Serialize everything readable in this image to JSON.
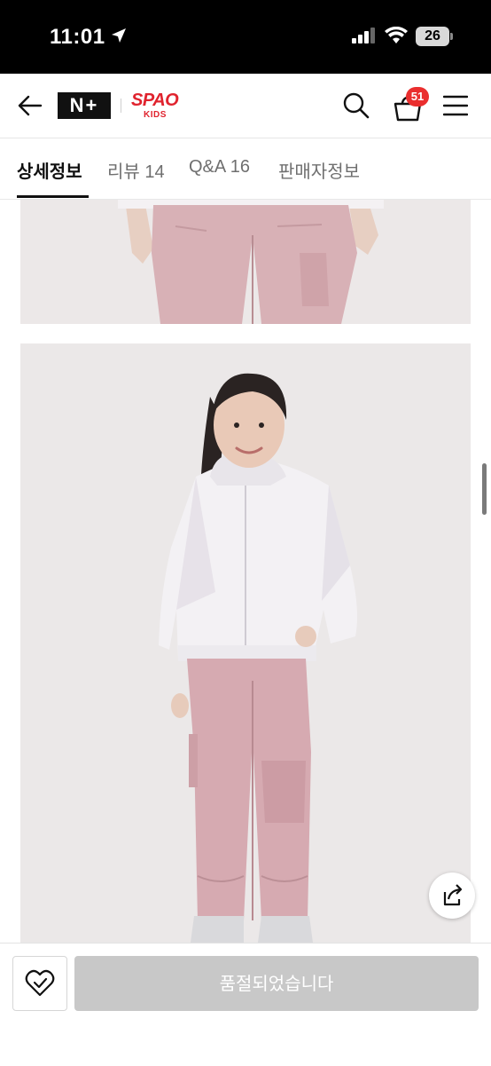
{
  "status_bar": {
    "time": "11:01",
    "battery": "26",
    "icons": [
      "location-arrow-icon",
      "signal-icon",
      "wifi-icon",
      "battery-icon"
    ]
  },
  "header": {
    "logo_text": "N+",
    "brand_line1": "SPAO",
    "brand_line2": "KIDS",
    "cart_count": "51",
    "brand_color": "#e0232e",
    "badge_color": "#ea2e2e",
    "icons": [
      "back-arrow-icon",
      "search-icon",
      "cart-icon",
      "menu-icon"
    ]
  },
  "tabs": [
    {
      "label": "상세정보",
      "active": true
    },
    {
      "label": "리뷰 14",
      "active": false
    },
    {
      "label": "Q&A 16",
      "active": false
    },
    {
      "label": "판매자정보",
      "active": false
    }
  ],
  "bottom_bar": {
    "soldout_label": "품절되었습니다",
    "icons": [
      "wishlist-heart-icon",
      "share-icon"
    ]
  }
}
